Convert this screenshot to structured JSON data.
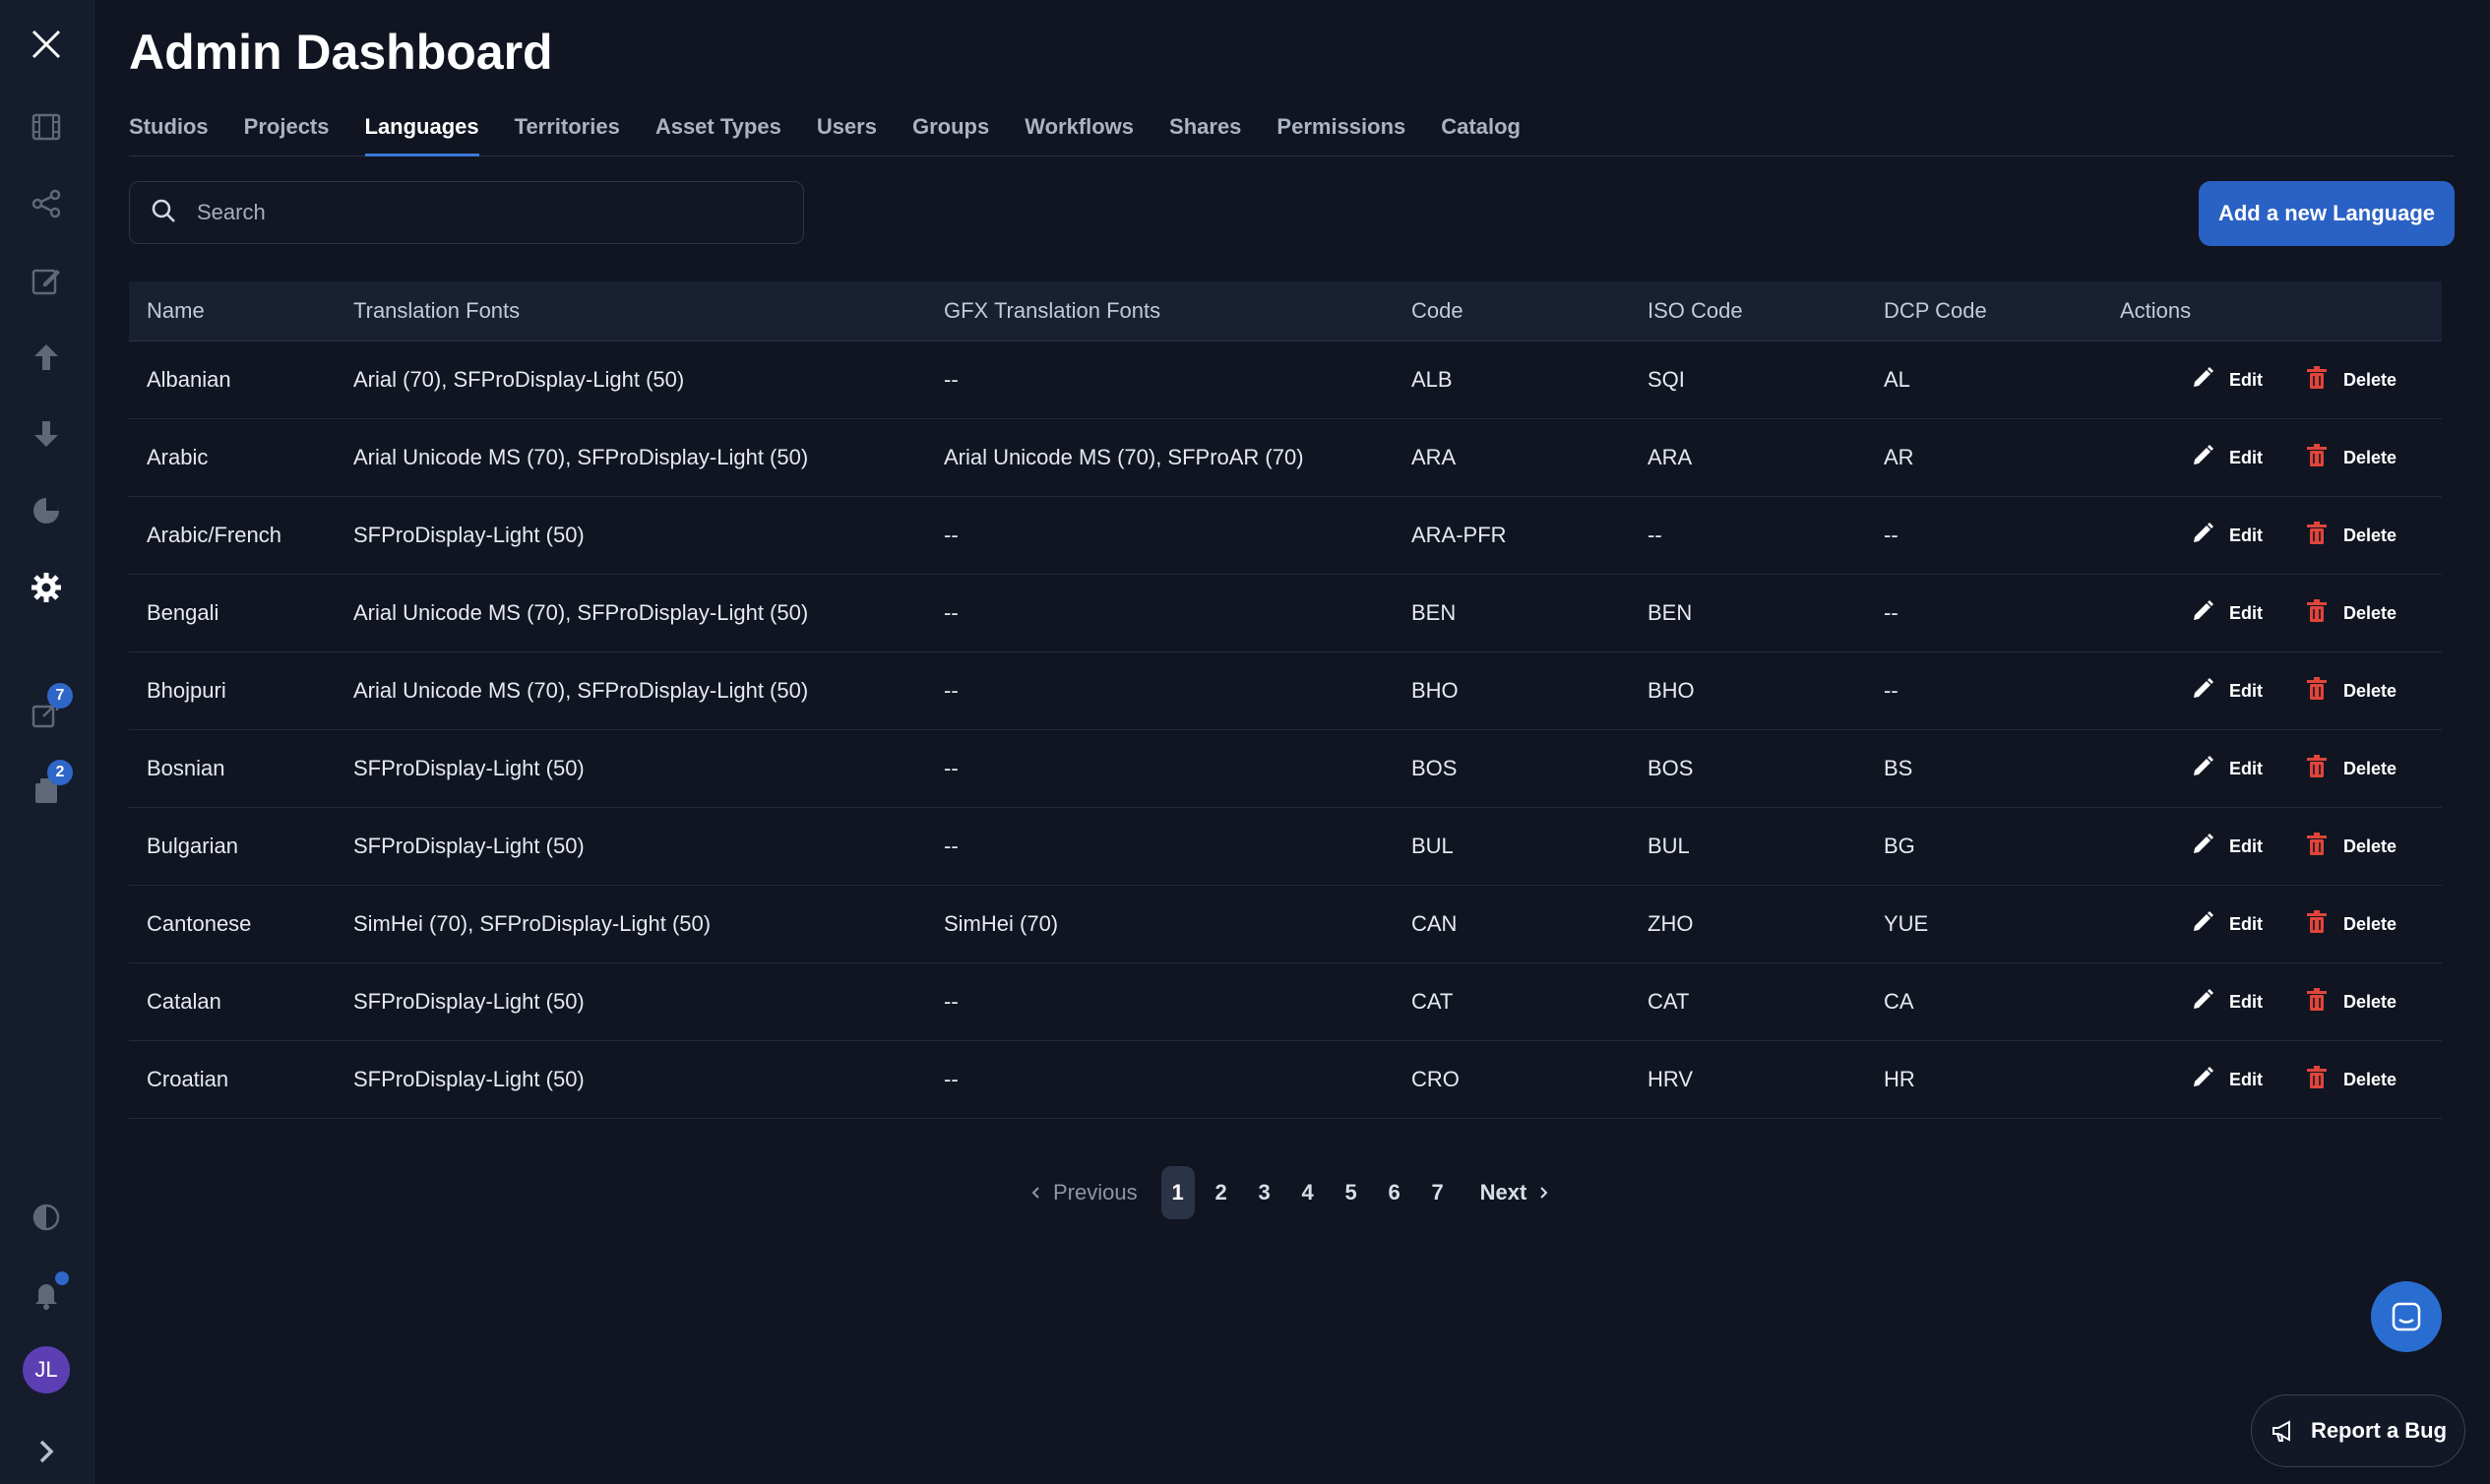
{
  "header": {
    "title": "Admin Dashboard"
  },
  "tabs": [
    {
      "label": "Studios"
    },
    {
      "label": "Projects"
    },
    {
      "label": "Languages",
      "active": true
    },
    {
      "label": "Territories"
    },
    {
      "label": "Asset Types"
    },
    {
      "label": "Users"
    },
    {
      "label": "Groups"
    },
    {
      "label": "Workflows"
    },
    {
      "label": "Shares"
    },
    {
      "label": "Permissions"
    },
    {
      "label": "Catalog"
    }
  ],
  "search": {
    "placeholder": "Search",
    "value": ""
  },
  "add_button": {
    "label": "Add a new Language"
  },
  "sidebar": {
    "badges": {
      "shares": "7",
      "tasks": "2"
    },
    "avatar_initials": "JL"
  },
  "table": {
    "columns": [
      "Name",
      "Translation Fonts",
      "GFX Translation Fonts",
      "Code",
      "ISO Code",
      "DCP Code",
      "Actions"
    ],
    "rows": [
      {
        "name": "Albanian",
        "fonts": "Arial (70), SFProDisplay-Light (50)",
        "gfx": "--",
        "code": "ALB",
        "iso": "SQI",
        "dcp": "AL"
      },
      {
        "name": "Arabic",
        "fonts": "Arial Unicode MS (70), SFProDisplay-Light (50)",
        "gfx": "Arial Unicode MS (70), SFProAR (70)",
        "code": "ARA",
        "iso": "ARA",
        "dcp": "AR"
      },
      {
        "name": "Arabic/French",
        "fonts": "SFProDisplay-Light (50)",
        "gfx": "--",
        "code": "ARA-PFR",
        "iso": "--",
        "dcp": "--"
      },
      {
        "name": "Bengali",
        "fonts": "Arial Unicode MS (70), SFProDisplay-Light (50)",
        "gfx": "--",
        "code": "BEN",
        "iso": "BEN",
        "dcp": "--"
      },
      {
        "name": "Bhojpuri",
        "fonts": "Arial Unicode MS (70), SFProDisplay-Light (50)",
        "gfx": "--",
        "code": "BHO",
        "iso": "BHO",
        "dcp": "--"
      },
      {
        "name": "Bosnian",
        "fonts": "SFProDisplay-Light (50)",
        "gfx": "--",
        "code": "BOS",
        "iso": "BOS",
        "dcp": "BS"
      },
      {
        "name": "Bulgarian",
        "fonts": "SFProDisplay-Light (50)",
        "gfx": "--",
        "code": "BUL",
        "iso": "BUL",
        "dcp": "BG"
      },
      {
        "name": "Cantonese",
        "fonts": "SimHei (70), SFProDisplay-Light (50)",
        "gfx": "SimHei (70)",
        "code": "CAN",
        "iso": "ZHO",
        "dcp": "YUE"
      },
      {
        "name": "Catalan",
        "fonts": "SFProDisplay-Light (50)",
        "gfx": "--",
        "code": "CAT",
        "iso": "CAT",
        "dcp": "CA"
      },
      {
        "name": "Croatian",
        "fonts": "SFProDisplay-Light (50)",
        "gfx": "--",
        "code": "CRO",
        "iso": "HRV",
        "dcp": "HR"
      }
    ],
    "edit_label": "Edit",
    "delete_label": "Delete"
  },
  "pagination": {
    "previous": "Previous",
    "next": "Next",
    "pages": [
      "1",
      "2",
      "3",
      "4",
      "5",
      "6",
      "7"
    ],
    "current": "1"
  },
  "report_bug": {
    "label": "Report a Bug"
  },
  "colors": {
    "accent": "#2a61c4",
    "delete": "#e0453a",
    "background": "#101521"
  }
}
